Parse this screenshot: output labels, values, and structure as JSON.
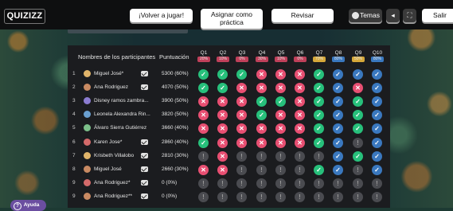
{
  "app": {
    "logo": "QUIZIZZ"
  },
  "topbar": {
    "play_again": "¡Volver a jugar!",
    "assign_line1": "Asignar como",
    "assign_line2": "práctica",
    "review": "Revisar",
    "themes": "Temas",
    "exit": "Salir"
  },
  "table": {
    "header_name": "Nombres de los participantes",
    "header_score": "Puntuación",
    "questions": [
      {
        "label": "Q1",
        "pct": "20%",
        "color": "#c0405a"
      },
      {
        "label": "Q2",
        "pct": "10%",
        "color": "#c0405a"
      },
      {
        "label": "Q3",
        "pct": "0%",
        "color": "#c0405a"
      },
      {
        "label": "Q4",
        "pct": "30%",
        "color": "#c0405a"
      },
      {
        "label": "Q5",
        "pct": "10%",
        "color": "#c0405a"
      },
      {
        "label": "Q6",
        "pct": "0%",
        "color": "#c0405a"
      },
      {
        "label": "Q7",
        "pct": "70%",
        "color": "#d6a83a"
      },
      {
        "label": "Q8",
        "pct": "80%",
        "color": "#3a78bf"
      },
      {
        "label": "Q9",
        "pct": "50%",
        "color": "#d6a83a"
      },
      {
        "label": "Q10",
        "pct": "80%",
        "color": "#3a78bf"
      }
    ],
    "rows": [
      {
        "num": "1",
        "name": "Miguel José*",
        "mail": true,
        "score": "5300 (60%)",
        "av": "#e0b46a",
        "cells": [
          "c",
          "c",
          "c",
          "w",
          "w",
          "w",
          "c",
          "b",
          "b",
          "b"
        ]
      },
      {
        "num": "2",
        "name": "Ana Rodriguez",
        "mail": true,
        "score": "4070 (50%)",
        "av": "#c98a62",
        "cells": [
          "c",
          "c",
          "w",
          "w",
          "w",
          "w",
          "c",
          "b",
          "w",
          "b"
        ]
      },
      {
        "num": "3",
        "name": "Disney ramos zambra...",
        "mail": false,
        "score": "3900 (50%)",
        "av": "#8b7bd0",
        "cells": [
          "w",
          "w",
          "w",
          "c",
          "c",
          "w",
          "c",
          "b",
          "c",
          "b"
        ]
      },
      {
        "num": "4",
        "name": "Leonela Alexandra Rin...",
        "mail": false,
        "score": "3820 (50%)",
        "av": "#6a9fd0",
        "cells": [
          "w",
          "w",
          "w",
          "c",
          "w",
          "w",
          "c",
          "b",
          "c",
          "b"
        ]
      },
      {
        "num": "5",
        "name": "Álvaro Sierra Gutiérrez",
        "mail": false,
        "score": "3660 (40%)",
        "av": "#7cc08a",
        "cells": [
          "w",
          "w",
          "w",
          "w",
          "w",
          "w",
          "c",
          "b",
          "c",
          "b"
        ]
      },
      {
        "num": "6",
        "name": "Karen Jose*",
        "mail": true,
        "score": "2860 (40%)",
        "av": "#d46a6a",
        "cells": [
          "c",
          "w",
          "w",
          "w",
          "w",
          "w",
          "c",
          "b",
          "u",
          "b"
        ]
      },
      {
        "num": "7",
        "name": "Krisbeth Villalobo",
        "mail": true,
        "score": "2810 (30%)",
        "av": "#e0b46a",
        "cells": [
          "u",
          "w",
          "u",
          "u",
          "u",
          "u",
          "u",
          "b",
          "c",
          "b"
        ]
      },
      {
        "num": "8",
        "name": "Miguel José",
        "mail": true,
        "score": "2660 (30%)",
        "av": "#c98a62",
        "cells": [
          "w",
          "w",
          "u",
          "u",
          "u",
          "u",
          "c",
          "b",
          "u",
          "b"
        ]
      },
      {
        "num": "9",
        "name": "Ana Rodriguez*",
        "mail": true,
        "score": "0 (0%)",
        "av": "#d46a6a",
        "cells": [
          "u",
          "u",
          "u",
          "u",
          "u",
          "u",
          "u",
          "u",
          "u",
          "u"
        ]
      },
      {
        "num": "9",
        "name": "Ana Rodriguez**",
        "mail": true,
        "score": "0 (0%)",
        "av": "#c98a62",
        "cells": [
          "u",
          "u",
          "u",
          "u",
          "u",
          "u",
          "u",
          "u",
          "u",
          "u"
        ]
      }
    ]
  },
  "help": {
    "label": "Ayuda"
  }
}
